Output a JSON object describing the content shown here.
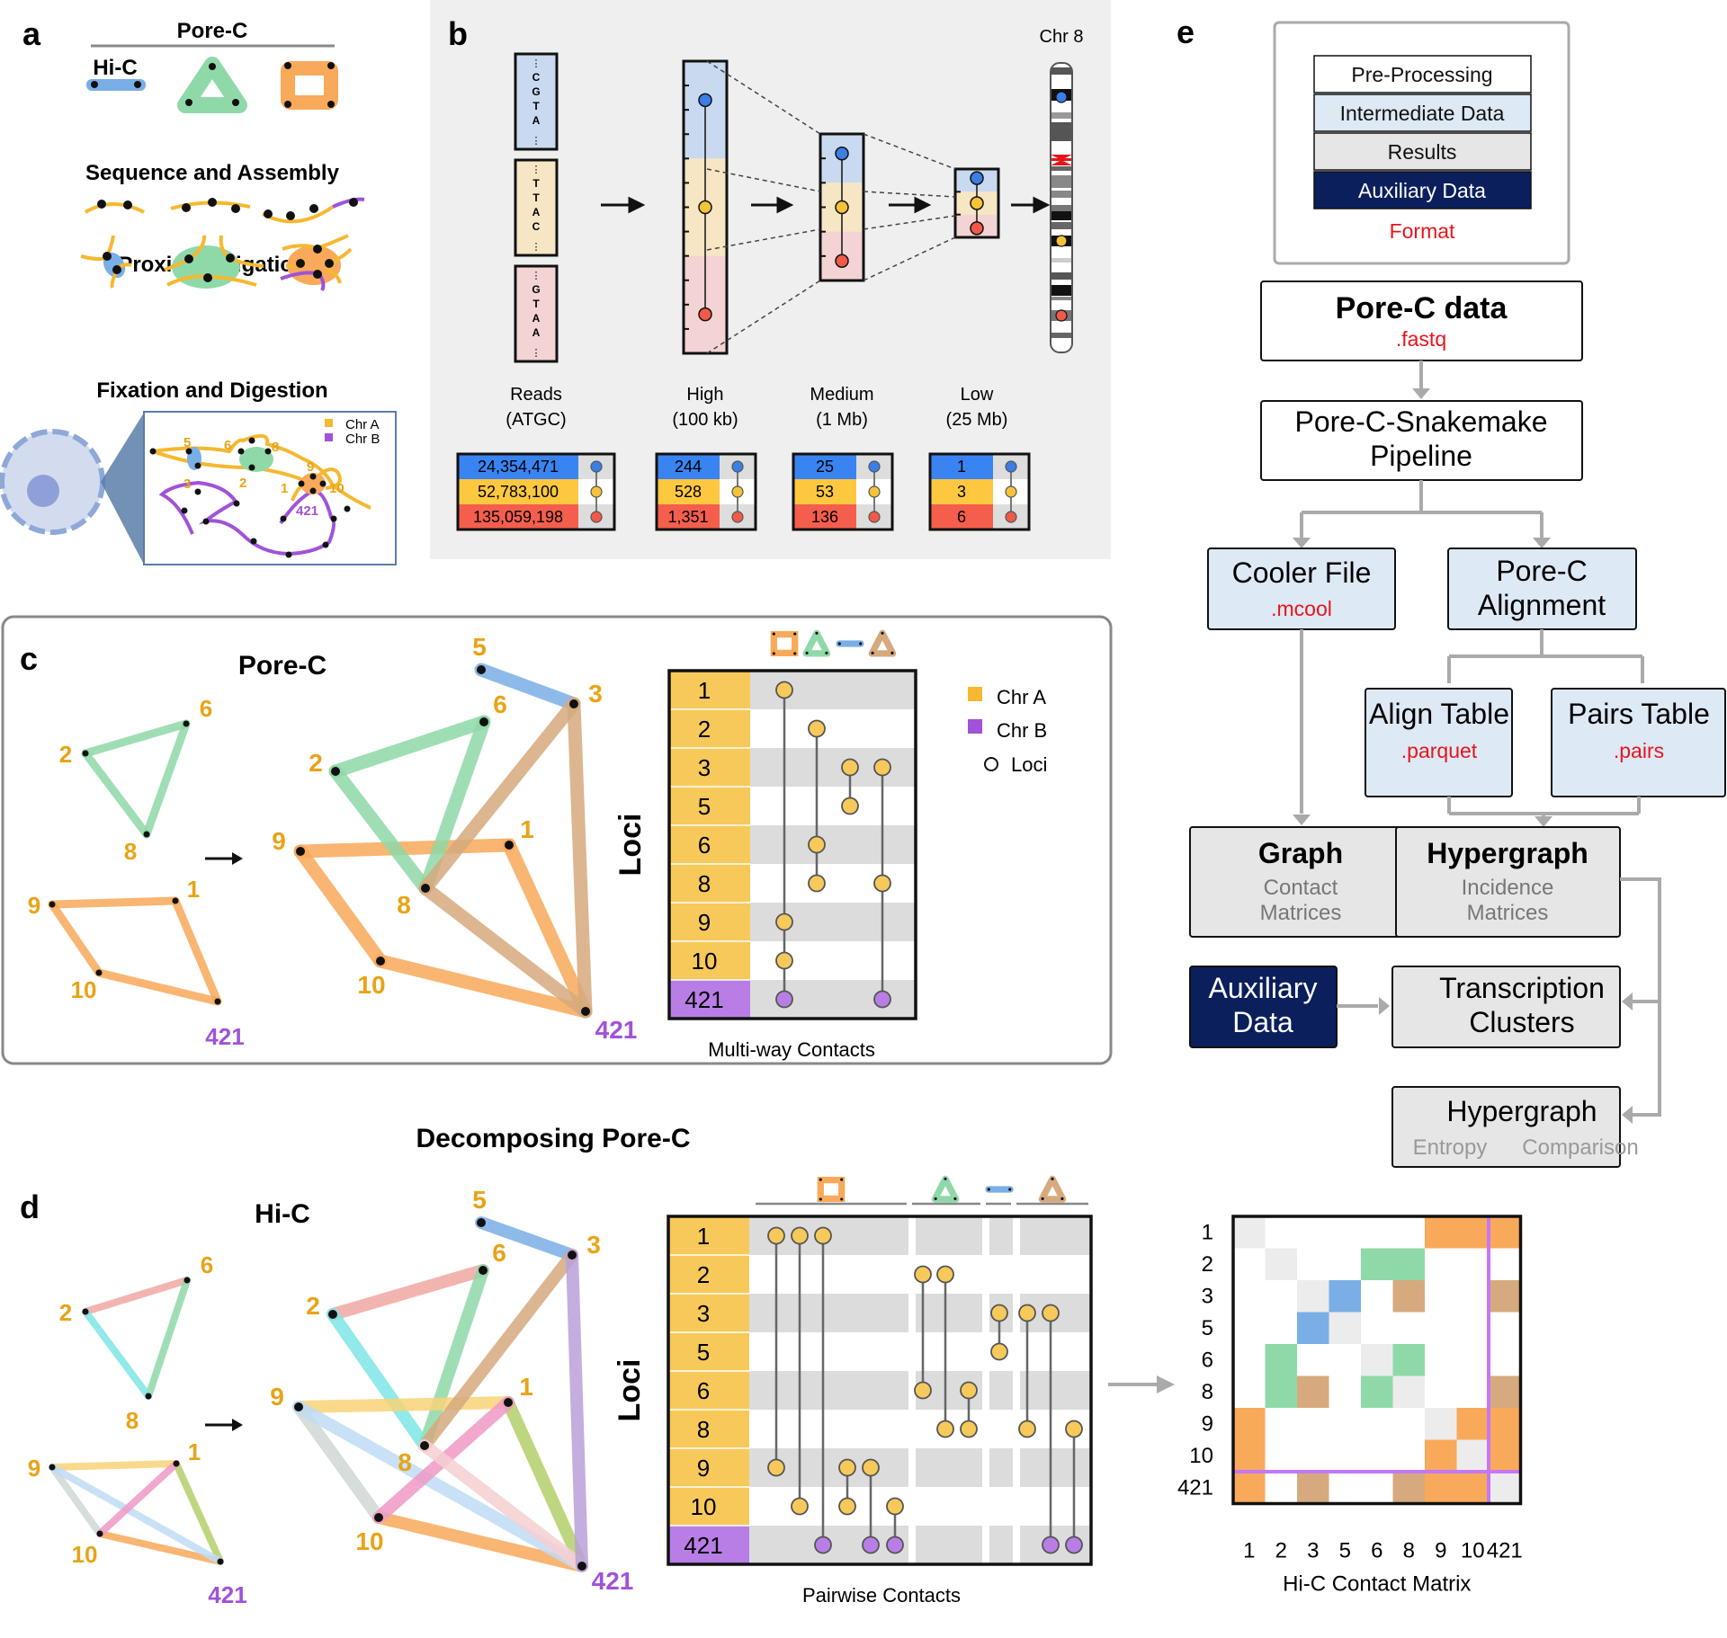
{
  "colors": {
    "chrA": "#f5b830",
    "chrA_label": "#e8a317",
    "chrB": "#a052d8",
    "blue": "#7aaee6",
    "green": "#8fd9a8",
    "orange": "#f9a95a",
    "tan": "#d6aa7e",
    "navy": "#0b1f5c",
    "red_format": "#e8141b",
    "box_light_blue": "#dde9f5",
    "box_gray": "#e6e6e6",
    "panel_b_bg": "#efefef"
  },
  "panel_a": {
    "label": "a",
    "porec_title": "Pore-C",
    "hic_title": "Hi-C",
    "sequence_title": "Sequence and Assembly",
    "ligation_title": "Proximity Ligation",
    "fixation_title": "Fixation and Digestion",
    "legend": [
      {
        "label": "Chr A",
        "color_key": "chrA"
      },
      {
        "label": "Chr B",
        "color_key": "chrB"
      }
    ],
    "loci_labels": [
      "5",
      "6",
      "8",
      "9",
      "3",
      "2",
      "1",
      "10",
      "421"
    ]
  },
  "panel_b": {
    "label": "b",
    "chromosome_title": "Chr 8",
    "read_letters": [
      [
        "C",
        "G",
        "T",
        "A"
      ],
      [
        "T",
        "T",
        "A",
        "C"
      ],
      [
        "G",
        "T",
        "A",
        "A"
      ]
    ],
    "columns": [
      {
        "name": "Reads",
        "sub": "(ATGC)",
        "counts": [
          "24,354,471",
          "52,783,100",
          "135,059,198"
        ]
      },
      {
        "name": "High",
        "sub": "(100 kb)",
        "counts": [
          "244",
          "528",
          "1,351"
        ]
      },
      {
        "name": "Medium",
        "sub": "(1 Mb)",
        "counts": [
          "25",
          "53",
          "136"
        ]
      },
      {
        "name": "Low",
        "sub": "(25 Mb)",
        "counts": [
          "1",
          "3",
          "6"
        ]
      }
    ]
  },
  "panel_c": {
    "label": "c",
    "title": "Pore-C",
    "y_axis_label": "Loci",
    "x_axis_label": "Multi-way Contacts",
    "loci": [
      "1",
      "2",
      "3",
      "5",
      "6",
      "8",
      "9",
      "10",
      "421"
    ],
    "loci_chr": [
      "A",
      "A",
      "A",
      "A",
      "A",
      "A",
      "A",
      "A",
      "B"
    ],
    "contacts": [
      {
        "shape": "square",
        "color_key": "orange",
        "loci": [
          "1",
          "9",
          "10",
          "421"
        ]
      },
      {
        "shape": "triangle",
        "color_key": "green",
        "loci": [
          "2",
          "6",
          "8"
        ]
      },
      {
        "shape": "edge",
        "color_key": "blue",
        "loci": [
          "3",
          "5"
        ]
      },
      {
        "shape": "triangle",
        "color_key": "tan",
        "loci": [
          "3",
          "8",
          "421"
        ]
      }
    ],
    "legend": [
      {
        "label": "Chr A",
        "kind": "square",
        "color_key": "chrA"
      },
      {
        "label": "Chr B",
        "kind": "square",
        "color_key": "chrB"
      },
      {
        "label": "Loci",
        "kind": "circle",
        "color_key": ""
      }
    ]
  },
  "panel_d": {
    "label": "d",
    "section_title": "Decomposing Pore-C",
    "title": "Hi-C",
    "y_axis_label": "Loci",
    "x_axis_label": "Pairwise Contacts",
    "matrix_label": "Hi-C Contact Matrix",
    "loci": [
      "1",
      "2",
      "3",
      "5",
      "6",
      "8",
      "9",
      "10",
      "421"
    ],
    "pair_groups": [
      {
        "shape": "square",
        "color_key": "orange",
        "pairs": [
          [
            "1",
            "9"
          ],
          [
            "1",
            "10"
          ],
          [
            "1",
            "421"
          ],
          [
            "9",
            "10"
          ],
          [
            "9",
            "421"
          ],
          [
            "10",
            "421"
          ]
        ]
      },
      {
        "shape": "triangle",
        "color_key": "green",
        "pairs": [
          [
            "2",
            "6"
          ],
          [
            "2",
            "8"
          ],
          [
            "6",
            "8"
          ]
        ]
      },
      {
        "shape": "edge",
        "color_key": "blue",
        "pairs": [
          [
            "3",
            "5"
          ]
        ]
      },
      {
        "shape": "triangle",
        "color_key": "tan",
        "pairs": [
          [
            "3",
            "8"
          ],
          [
            "3",
            "421"
          ],
          [
            "8",
            "421"
          ]
        ]
      }
    ]
  },
  "panel_e": {
    "label": "e",
    "legend_items": [
      {
        "label": "Pre-Processing",
        "style": "white"
      },
      {
        "label": "Intermediate Data",
        "style": "lightblue"
      },
      {
        "label": "Results",
        "style": "gray"
      },
      {
        "label": "Auxiliary Data",
        "style": "navy"
      }
    ],
    "legend_format": "Format",
    "nodes": {
      "porec_data": {
        "title": "Pore-C data",
        "format": ".fastq"
      },
      "pipeline": {
        "title": "Pore-C-Snakemake\nPipeline"
      },
      "cooler": {
        "title": "Cooler File",
        "format": ".mcool"
      },
      "alignment": {
        "title": "Pore-C\nAlignment"
      },
      "align_table": {
        "title": "Align Table",
        "format": ".parquet"
      },
      "pairs_table": {
        "title": "Pairs Table",
        "format": ".pairs"
      },
      "graph": {
        "title": "Graph",
        "sub": "Contact\nMatrices"
      },
      "hypergraph": {
        "title": "Hypergraph",
        "sub": "Incidence\nMatrices"
      },
      "aux": {
        "title": "Auxiliary\nData"
      },
      "transcription": {
        "title": "Transcription\nClusters"
      },
      "hyper_analysis": {
        "title": "Hypergraph",
        "sub_left": "Entropy",
        "sub_right": "Comparison"
      }
    }
  }
}
